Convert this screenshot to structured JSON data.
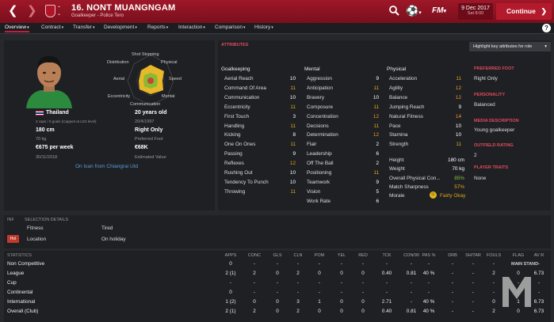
{
  "header": {
    "player_name": "16. NONT MUANGNGAM",
    "subtitle": "Goalkeeper - Police Tero",
    "date": "9 Dec 2017",
    "weekday_time": "Sat 8:00",
    "continue_label": "Continue",
    "fm_logo": "FM"
  },
  "tabs": [
    "Overview",
    "Contract",
    "Transfer",
    "Development",
    "Reports",
    "Interaction",
    "Comparison",
    "History"
  ],
  "profile": {
    "nation": "Thailand",
    "caps": "3 caps / 0 goals (Capped at U23 level)",
    "age": "20 years old",
    "dob": "20/4/1997",
    "height": "180 cm",
    "weight": "70 kg",
    "foot": "Right Only",
    "foot_label": "Preferred Foot",
    "wage": "€675 per week",
    "contract_end": "30/11/2018",
    "value": "€68K",
    "value_label": "Estimated Value",
    "loan": "On loan from Chiangrai Utd"
  },
  "radar": {
    "labels": [
      "Shot Stopping",
      "Physical",
      "Speed",
      "Mental",
      "Communication",
      "Eccentricity",
      "Aerial",
      "Distribution"
    ]
  },
  "attributes": {
    "title": "ATTRIBUTES",
    "highlight_label": "Highlight key attributes for role",
    "goalkeeping": {
      "title": "Goalkeeping",
      "items": [
        [
          "Aerial Reach",
          "10"
        ],
        [
          "Command Of Area",
          "11"
        ],
        [
          "Communication",
          "10"
        ],
        [
          "Eccentricity",
          "11"
        ],
        [
          "First Touch",
          "3"
        ],
        [
          "Handling",
          "11"
        ],
        [
          "Kicking",
          "8"
        ],
        [
          "One On Ones",
          "11"
        ],
        [
          "Passing",
          "9"
        ],
        [
          "Reflexes",
          "12"
        ],
        [
          "Rushing Out",
          "10"
        ],
        [
          "Tendency To Punch",
          "10"
        ],
        [
          "Throwing",
          "11"
        ]
      ]
    },
    "mental": {
      "title": "Mental",
      "items": [
        [
          "Aggression",
          "9"
        ],
        [
          "Anticipation",
          "11"
        ],
        [
          "Bravery",
          "10"
        ],
        [
          "Composure",
          "11"
        ],
        [
          "Concentration",
          "12"
        ],
        [
          "Decisions",
          "11"
        ],
        [
          "Determination",
          "12"
        ],
        [
          "Flair",
          "2"
        ],
        [
          "Leadership",
          "6"
        ],
        [
          "Off The Ball",
          "2"
        ],
        [
          "Positioning",
          "11"
        ],
        [
          "Teamwork",
          "9"
        ],
        [
          "Vision",
          "5"
        ],
        [
          "Work Rate",
          "6"
        ]
      ]
    },
    "physical": {
      "title": "Physical",
      "items": [
        [
          "Acceleration",
          "11"
        ],
        [
          "Agility",
          "12"
        ],
        [
          "Balance",
          "12"
        ],
        [
          "Jumping Reach",
          "9"
        ],
        [
          "Natural Fitness",
          "14"
        ],
        [
          "Pace",
          "10"
        ],
        [
          "Stamina",
          "10"
        ],
        [
          "Strength",
          "11"
        ]
      ]
    },
    "extras": [
      [
        "Height",
        "180 cm"
      ],
      [
        "Weight",
        "70 kg"
      ],
      [
        "Overall Physical Con...",
        "85%"
      ],
      [
        "Match Sharpness",
        "57%"
      ],
      [
        "Morale",
        "Fairly Okay"
      ]
    ]
  },
  "side": {
    "preferred_foot_title": "PREFERRED FOOT",
    "preferred_foot": "Right Only",
    "personality_title": "PERSONALITY",
    "personality": "Balanced",
    "media_title": "MEDIA DESCRIPTION",
    "media": "Young goalkeeper",
    "rating_title": "OUTFIELD RATING",
    "rating": "2",
    "traits_title": "PLAYER TRAITS",
    "traits": "None"
  },
  "info": {
    "inf_title": "INF",
    "selection_title": "SELECTION DETAILS",
    "fitness_label": "Fitness",
    "fitness_value": "Tired",
    "location_label": "Location",
    "location_value": "On holiday",
    "badge": "Hol"
  },
  "stats": {
    "title": "STATISTICS",
    "columns": [
      "APPS",
      "CONC",
      "GLS",
      "CLN",
      "POM",
      "YEL",
      "RED",
      "TCK",
      "CON/90",
      "PAS %",
      "DRB",
      "SH/TAR",
      "FOULS",
      "FLAG",
      "AV R"
    ],
    "rows": [
      {
        "name": "Non Competitive",
        "v": [
          "0",
          "-",
          "-",
          "-",
          "-",
          "-",
          "-",
          "-",
          "-",
          "-",
          "-",
          "-",
          "-",
          "-",
          "-"
        ]
      },
      {
        "name": "League",
        "v": [
          "2 (1)",
          "2",
          "0",
          "2",
          "0",
          "0",
          "0",
          "0.40",
          "0.81",
          "40 %",
          "-",
          "-",
          "2",
          "0",
          "6.73"
        ]
      },
      {
        "name": "Cup",
        "v": [
          "-",
          "-",
          "-",
          "-",
          "-",
          "-",
          "-",
          "-",
          "-",
          "-",
          "-",
          "-",
          "-",
          "-",
          "-"
        ]
      },
      {
        "name": "Continental",
        "v": [
          "0",
          "-",
          "-",
          "-",
          "-",
          "-",
          "-",
          "-",
          "-",
          "-",
          "-",
          "-",
          "-",
          "-",
          "-"
        ]
      },
      {
        "name": "International",
        "v": [
          "1 (2)",
          "0",
          "0",
          "3",
          "1",
          "0",
          "0",
          "2.71",
          "-",
          "40 %",
          "-",
          "-",
          "0",
          "1",
          "6.73"
        ]
      },
      {
        "name": "Overall (Club)",
        "v": [
          "2 (1)",
          "2",
          "0",
          "2",
          "0",
          "0",
          "0",
          "0.40",
          "0.81",
          "40 %",
          "-",
          "-",
          "2",
          "0",
          "6.73"
        ]
      }
    ],
    "watermark": "MAIN STAND"
  }
}
